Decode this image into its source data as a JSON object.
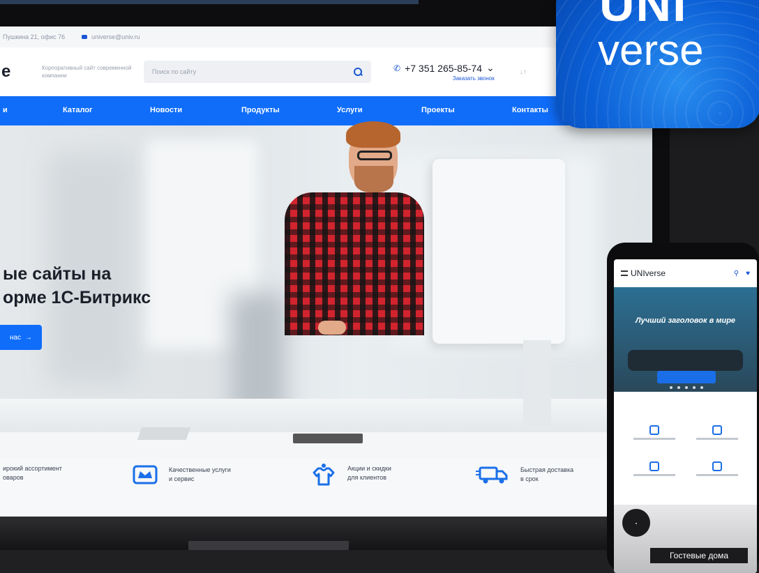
{
  "topbar": {
    "address": "Пушкина 21, офис 76",
    "email": "universe@univ.ru"
  },
  "header": {
    "logo_fragment": "e",
    "tagline": "Корпоративный сайт современной компании",
    "search_placeholder": "Поиск по сайту",
    "phone": "+7 351 265-85-74",
    "phone_caret": "⌄",
    "callback": "Заказать звонок",
    "compare_icon_text": "↓↑"
  },
  "nav": {
    "items": [
      "и",
      "Каталог",
      "Новости",
      "Продукты",
      "Услуги",
      "Проекты",
      "Контакты"
    ]
  },
  "hero": {
    "title_line1": "ые сайты на",
    "title_line2": "орме 1С-Битрикс",
    "cta_label": "нас",
    "cta_arrow": "→"
  },
  "features": [
    {
      "text1": "ирокий ассортимент",
      "text2": "оваров",
      "icon": "box-icon"
    },
    {
      "text1": "Качественные услуги",
      "text2": "и сервис",
      "icon": "crown-icon"
    },
    {
      "text1": "Акции и скидки",
      "text2": "для клиентов",
      "icon": "tshirt-icon"
    },
    {
      "text1": "Быстрая доставка",
      "text2": "в срок",
      "icon": "truck-icon"
    }
  ],
  "phone_device": {
    "logo": "UNIverse",
    "hero_title": "Лучший заголовок в мире",
    "caption": "Гостевые дома"
  },
  "app_icon": {
    "top": "UNI",
    "bottom": "verse"
  },
  "colors": {
    "accent": "#0f6dfa",
    "text": "#1b1f2a"
  }
}
